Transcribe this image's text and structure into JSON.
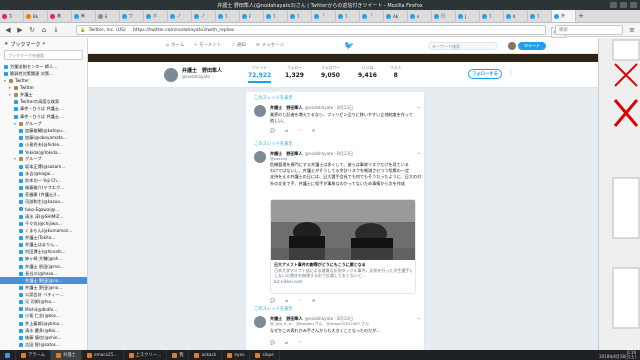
{
  "window": {
    "title": "弁護士 野田隼人(@nodahayato3)さん | Twitterからの返信付きツイート - Mozilla Firefox"
  },
  "tabs": [
    {
      "label": "Ti",
      "fav": "pink"
    },
    {
      "label": "Bk",
      "fav": "orange"
    },
    {
      "label": "着",
      "fav": "pink"
    },
    {
      "label": "新",
      "fav": ""
    },
    {
      "label": "E",
      "fav": "gray"
    },
    {
      "label": "ワ",
      "fav": ""
    },
    {
      "label": "ホ",
      "fav": ""
    },
    {
      "label": "ノ",
      "fav": ""
    },
    {
      "label": "ノ",
      "fav": ""
    },
    {
      "label": "T",
      "fav": ""
    },
    {
      "label": "F",
      "fav": ""
    },
    {
      "label": "T",
      "fav": ""
    },
    {
      "label": "T",
      "fav": ""
    },
    {
      "label": "「",
      "fav": ""
    },
    {
      "label": "T",
      "fav": ""
    },
    {
      "label": "「",
      "fav": ""
    },
    {
      "label": "Ab",
      "fav": ""
    },
    {
      "label": "e",
      "fav": ""
    },
    {
      "label": "日",
      "fav": ""
    },
    {
      "label": "J",
      "fav": ""
    },
    {
      "label": "T",
      "fav": ""
    },
    {
      "label": "K",
      "fav": ""
    },
    {
      "label": "T",
      "fav": ""
    },
    {
      "label": "弁",
      "fav": ""
    }
  ],
  "navbar": {
    "cert": "Twitter, Inc. (US)",
    "url": "https://twitter.com/nodahayato3/with_replies",
    "zoom": "90%",
    "search_placeholder": "検索"
  },
  "sidebar": {
    "title": "ブックマーク",
    "search_placeholder": "ブックマークを検索",
    "items": [
      {
        "label": "労働法制センター 師人...",
        "type": "page",
        "indent": 0
      },
      {
        "label": "脆弱性対策関連 対策...",
        "type": "page",
        "indent": 0
      },
      {
        "label": "Twitter",
        "type": "folder",
        "indent": 0
      },
      {
        "label": "Twitter",
        "type": "folder",
        "indent": 1
      },
      {
        "label": "弁護士",
        "type": "folder",
        "indent": 1
      },
      {
        "label": "Twitterの高度な検索",
        "type": "page",
        "indent": 2
      },
      {
        "label": "事件・ひうば 弁護士...",
        "type": "page",
        "indent": 2
      },
      {
        "label": "事件・ひうば 弁護士...",
        "type": "page",
        "indent": 2
      },
      {
        "label": "グループ",
        "type": "folder",
        "indent": 2
      },
      {
        "label": "加藤雄輔(@katoyu...",
        "type": "page",
        "indent": 3
      },
      {
        "label": "加藤(@oboyamata...",
        "type": "page",
        "indent": 3
      },
      {
        "label": "小島秀夫(@hideo...",
        "type": "page",
        "indent": 3
      },
      {
        "label": "Yokida(@Yokida...",
        "type": "page",
        "indent": 3
      },
      {
        "label": "グループ",
        "type": "folder",
        "indent": 2
      },
      {
        "label": "坂本正博(@sakam...",
        "type": "page",
        "indent": 3
      },
      {
        "label": "永吉(@kogai...",
        "type": "page",
        "indent": 3
      },
      {
        "label": "鈴木功一 Yoji Ch...",
        "type": "page",
        "indent": 3
      },
      {
        "label": "後藤雄介(ヤフエク...",
        "type": "page",
        "indent": 3
      },
      {
        "label": "荘厳康 (弁護士)(...",
        "type": "page",
        "indent": 3
      },
      {
        "label": "河部和生(@kazuo...",
        "type": "page",
        "indent": 3
      },
      {
        "label": "fuko-Egawa(@...",
        "type": "page",
        "indent": 3
      },
      {
        "label": "清水 淳(@SHIMIZ...",
        "type": "page",
        "indent": 3
      },
      {
        "label": "千々丸(@chijiwa...",
        "type": "page",
        "indent": 3
      },
      {
        "label": "くまもん(@kumamon...",
        "type": "page",
        "indent": 3
      },
      {
        "label": "弁護士(Tokita...",
        "type": "page",
        "indent": 3
      },
      {
        "label": "弁護士はまりん...",
        "type": "page",
        "indent": 3
      },
      {
        "label": "村田博士(@hiroshi...",
        "type": "page",
        "indent": 3
      },
      {
        "label": "姉ヶ崎 大輔(@oh...",
        "type": "page",
        "indent": 3
      },
      {
        "label": "弁護士 前田(@ma...",
        "type": "page",
        "indent": 3
      },
      {
        "label": "長谷川(@hase...",
        "type": "page",
        "indent": 3
      },
      {
        "label": "弁護士 野田(@no...",
        "type": "page",
        "indent": 3,
        "selected": true
      },
      {
        "label": "弁護士 野田(@no...",
        "type": "page",
        "indent": 3
      },
      {
        "label": "公認会計 ベティー...",
        "type": "page",
        "indent": 3
      },
      {
        "label": "兄 司郎(@tsu...",
        "type": "page",
        "indent": 3
      },
      {
        "label": "Mishi(@dkdhi...",
        "type": "page",
        "indent": 3
      },
      {
        "label": "小坂 仁志(@kos...",
        "type": "page",
        "indent": 3
      },
      {
        "label": "井上義郎(@ybino...",
        "type": "page",
        "indent": 3
      },
      {
        "label": "清水 慶多(@Kei...",
        "type": "page",
        "indent": 3
      },
      {
        "label": "後藤 慎也(@shin...",
        "type": "page",
        "indent": 3
      },
      {
        "label": "吉田 智(@satos...",
        "type": "page",
        "indent": 3
      }
    ]
  },
  "twitter_nav": {
    "home": "ホーム",
    "moments": "モーメント",
    "notifications": "通知",
    "messages": "メッセージ",
    "search_placeholder": "キーワード検索",
    "tweet_button": "ツイート"
  },
  "profile": {
    "name": "弁護士　野田隼人",
    "handle": "@nodahayato",
    "stats": [
      {
        "label": "ツイート",
        "value": "72,922",
        "active": true
      },
      {
        "label": "フォロー",
        "value": "1,329",
        "active": false
      },
      {
        "label": "フォロワー",
        "value": "9,050",
        "active": false
      },
      {
        "label": "いいね",
        "value": "9,416",
        "active": false
      },
      {
        "label": "リスト",
        "value": "8",
        "active": false
      }
    ],
    "follow_button": "フォローする"
  },
  "feed": {
    "thread_link_1": "このスレッドを表示",
    "thread_link_2": "このスレッドを表示",
    "thread_link_3": "このスレッドを表示",
    "tweets": [
      {
        "name": "弁護士　野田隼人",
        "handle": "@nodahayato · 8月13日",
        "lines": [
          "業界のじ記者を増えてるなら、フィリピン辺りに移いやすい立地制度を作って",
          "欲しい。"
        ],
        "counts": [
          "",
          "",
          ""
        ]
      },
      {
        "name": "弁護士　野田隼人",
        "handle": "@nodahayato · 8月13日",
        "sub": "@xxxxxx",
        "lines": [
          "危機管理を専門にする弁護士は多くして、彼らは事故リスクだけを見ている",
          "わけではないし、弁護士がそうしてる余計リスクを軽減させつつ危篤の一定",
          "支持をえる弁護士の日には、日大選手会長でも何でもそうだったように、日大の対",
          "外の文化で手、弁護士に相手が事故なのかってないため事情から文を作成"
        ],
        "media": {
          "headline": "日大アメフト事件の謝罪がどうにもこうに要となる",
          "desc": "日本大学アメフト部による悪質な反則タックル事件。反則を行った学生選手に対し、",
          "desc2": "しないの責任を無視する形で反論しておくないと...",
          "url": "biz.nikkei.com"
        },
        "counts": [
          "",
          "",
          ""
        ]
      },
      {
        "name": "弁護士　野田隼人",
        "handle": "@nodahayato · 8月13日",
        "sub": "@_tdo_tr_a 、@kdaidai さん、@amoo70072467 さん",
        "lines": [
          "なぜかこの表れかみ手さんからも大きくことなったのだが..."
        ],
        "counts": [
          "",
          "",
          ""
        ]
      }
    ]
  },
  "taskbar": {
    "items": [
      "アラーム",
      "弁護士",
      "emacs25...",
      "上スクリー...",
      "我",
      "ackack",
      "eyes",
      "slope"
    ],
    "time": "0:19",
    "date": "2018年8月18日(土)"
  }
}
